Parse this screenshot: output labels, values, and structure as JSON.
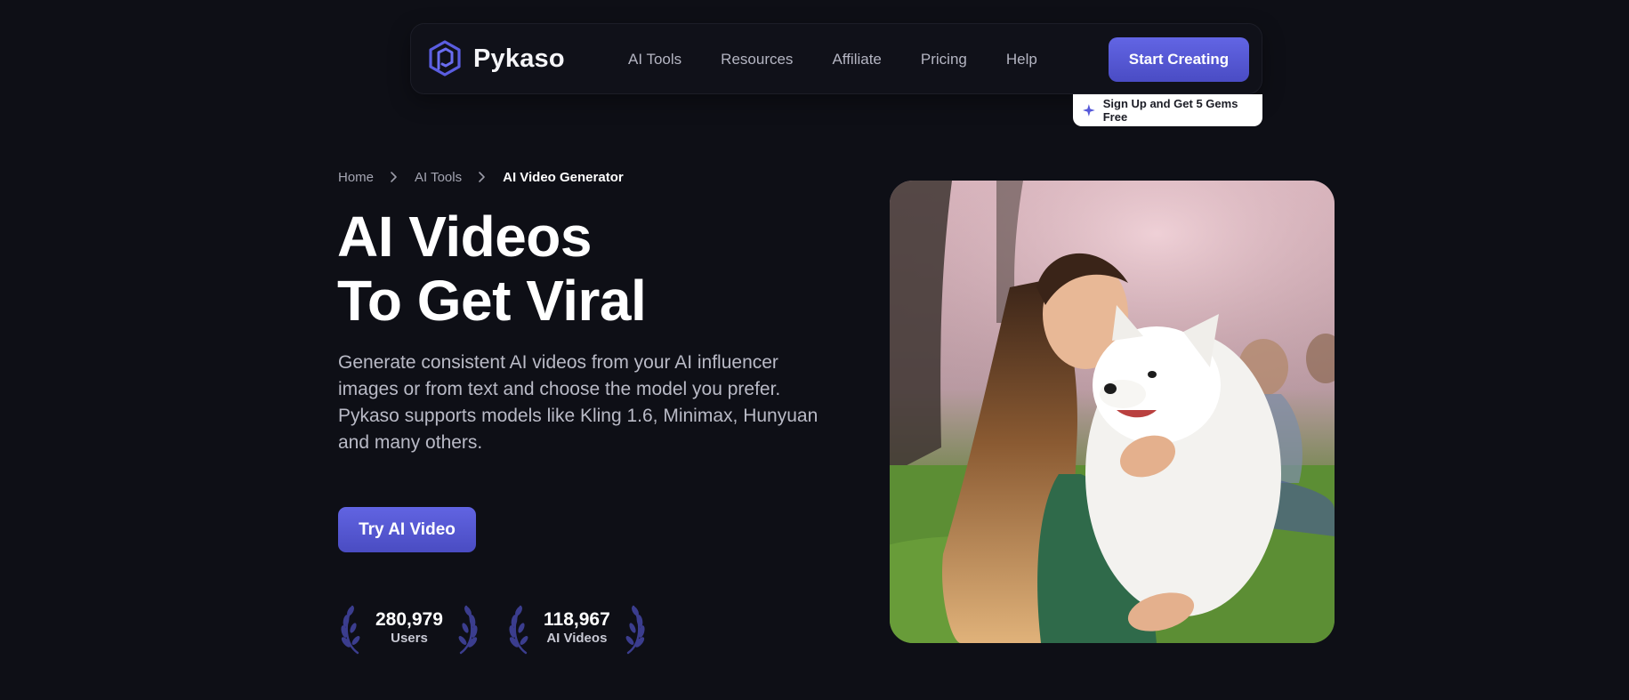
{
  "brand": {
    "name": "Pykaso",
    "accent": "#5558d9"
  },
  "nav": {
    "links": [
      "AI Tools",
      "Resources",
      "Affiliate",
      "Pricing",
      "Help"
    ],
    "cta_label": "Start Creating",
    "promo_label": "Sign Up and Get 5 Gems Free"
  },
  "breadcrumb": [
    "Home",
    "AI Tools",
    "AI Video Generator"
  ],
  "hero": {
    "title_line1": "AI Videos",
    "title_line2": "To Get Viral",
    "description": "Generate consistent AI videos from your AI influencer images or from text and choose the model you prefer. Pykaso supports models like Kling 1.6, Minimax, Hunyuan and many others.",
    "cta_label": "Try AI Video"
  },
  "stats": [
    {
      "value": "280,979",
      "label": "Users"
    },
    {
      "value": "118,967",
      "label": "AI Videos"
    }
  ],
  "icons": {
    "logo": "hexagon-logo-icon",
    "promo": "sparkle-icon",
    "breadcrumb_sep": "chevron-right-icon",
    "stat_decoration": "laurel-icon"
  }
}
